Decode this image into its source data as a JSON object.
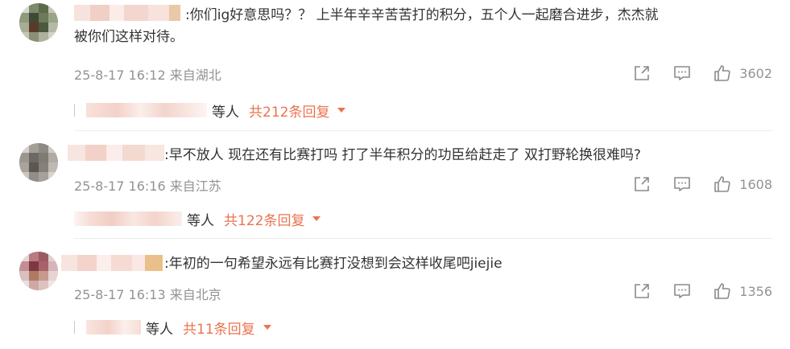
{
  "comments": [
    {
      "text_line1": ":你们ig好意思吗？？ 上半年辛辛苦苦打的积分，五个人一起磨合进步，杰杰就",
      "text_line2": "被你们这样对待。",
      "time": "25-8-17 16:12 来自湖北",
      "likes": "3602",
      "replies_people": "等人",
      "replies_total": "共212条回复"
    },
    {
      "text_line1": ":早不放人 现在还有比赛打吗 打了半年积分的功臣给赶走了 双打野轮换很难吗?",
      "time": "25-8-17 16:16 来自江苏",
      "likes": "1608",
      "replies_people": "等人",
      "replies_total": "共122条回复"
    },
    {
      "text_line1": ":年初的一句希望永远有比赛打没想到会这样收尾吧jiejie",
      "time": "25-8-17 16:13 来自北京",
      "likes": "1356",
      "replies_people": "等人",
      "replies_total": "共11条回复"
    }
  ],
  "icons": {
    "share": "share-icon",
    "comment": "comment-icon",
    "like": "thumbs-up-icon",
    "expand": "caret-down-icon"
  },
  "colors": {
    "text": "#333333",
    "meta": "#939393",
    "accent": "#eb7350"
  }
}
